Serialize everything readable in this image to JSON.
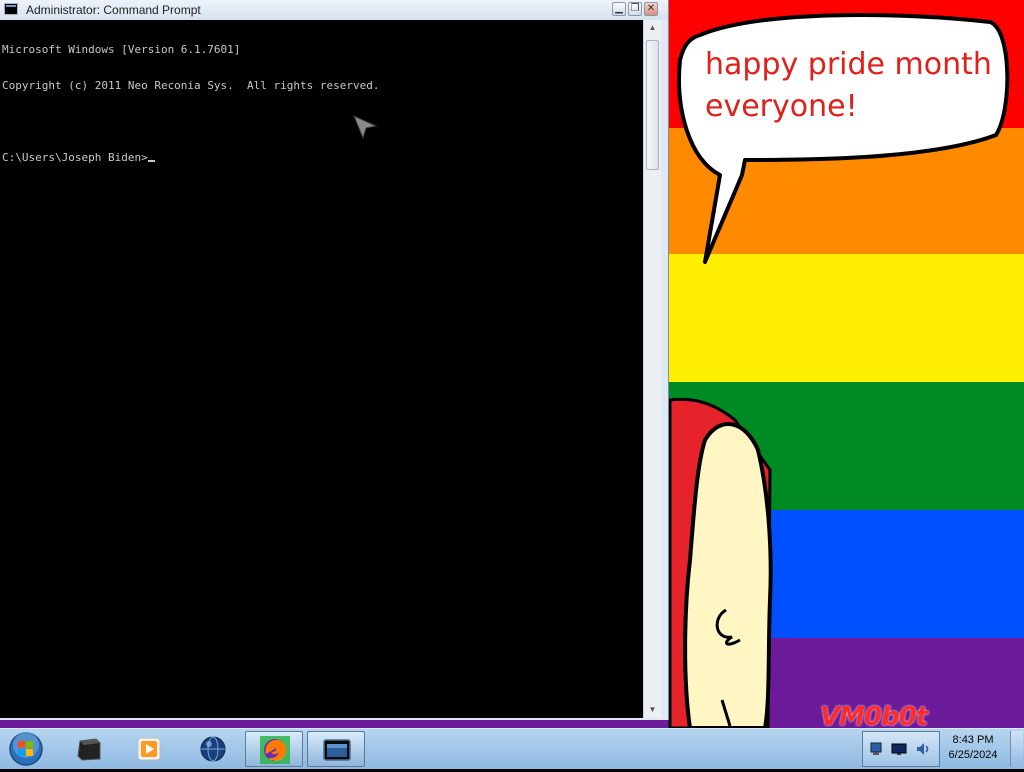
{
  "window": {
    "title": "Administrator: Command Prompt",
    "title_icon": "console-icon",
    "buttons": {
      "minimize": "minimize-icon",
      "restore": "restore-icon",
      "close": "close-icon"
    }
  },
  "console": {
    "lines": [
      "Microsoft Windows [Version 6.1.7601]",
      "Copyright (c) 2011 Neo Reconia Sys.  All rights reserved.",
      "",
      "C:\\Users\\Joseph Biden>"
    ],
    "text_color": "#c8c8c8",
    "background": "#000000"
  },
  "wallpaper": {
    "speech_bubble_text": "happy pride month everyone!",
    "watermark": "VM0b0t",
    "stripe_colors": [
      "#ff0000",
      "#ff8a00",
      "#ffee00",
      "#008a23",
      "#0050ff",
      "#6b1b9a"
    ]
  },
  "taskbar": {
    "start_button": "windows-start-icon",
    "items": [
      {
        "name": "terminal-icon",
        "active": false
      },
      {
        "name": "media-player-icon",
        "active": false
      },
      {
        "name": "globe-icon",
        "active": false
      },
      {
        "name": "firefox-icon",
        "active": true
      },
      {
        "name": "console-icon",
        "active": true
      }
    ],
    "tray_icons": [
      "network-icon",
      "display-icon",
      "volume-icon"
    ],
    "clock_time": "8:43 PM",
    "clock_date": "6/25/2024"
  }
}
